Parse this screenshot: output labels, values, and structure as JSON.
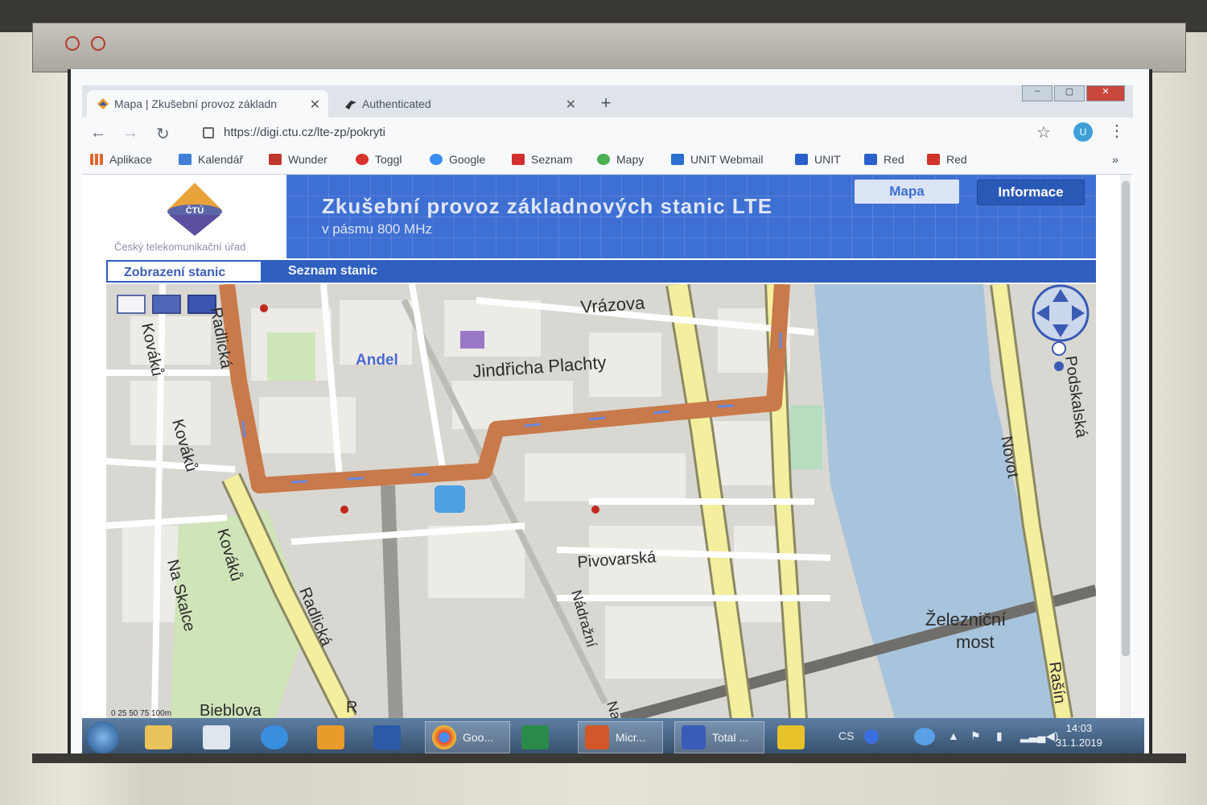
{
  "browser": {
    "tabs": [
      {
        "label": "Mapa | Zkušební provoz základn"
      },
      {
        "label": "Authenticated"
      }
    ],
    "url": "https://digi.ctu.cz/lte-zp/pokryti",
    "avatar_letter": "U",
    "bookmarks": [
      {
        "label": "Aplikace",
        "color": "#e0662b"
      },
      {
        "label": "Kalendář",
        "color": "#3f7fd6"
      },
      {
        "label": "Wunder",
        "color": "#c2372b"
      },
      {
        "label": "Toggl",
        "color": "#d9342b"
      },
      {
        "label": "Google",
        "color": "#3c8df0"
      },
      {
        "label": "Seznam",
        "color": "#d32f2f"
      },
      {
        "label": "Mapy",
        "color": "#4caf50"
      },
      {
        "label": "UNIT Webmail",
        "color": "#2b6fd0"
      },
      {
        "label": "UNIT",
        "color": "#2b5fc9"
      },
      {
        "label": "Red",
        "color": "#2b5fc9"
      },
      {
        "label": "Red",
        "color": "#d1342b"
      }
    ]
  },
  "site": {
    "logo_abbr": "ČTÚ",
    "logo_caption": "Český telekomunikační úřad",
    "title": "Zkušební provoz základnových stanic LTE",
    "subtitle": "v pásmu 800 MHz",
    "nav_buttons": [
      "Mapa",
      "Informace"
    ],
    "subtabs": [
      "Zobrazení stanic",
      "Seznam stanic"
    ]
  },
  "map": {
    "streets": [
      "Vrázova",
      "Jindřicha Plachty",
      "Andel",
      "Radlická",
      "Kováků",
      "Kováků",
      "Kováků",
      "Na Skalce",
      "Radlická",
      "Pivovarská",
      "Nádražní",
      "Na",
      "Bieblova",
      "R",
      "Novot",
      "Podskalská",
      "Železniční",
      "most",
      "Rašín"
    ],
    "scale": "0  25  50  75  100m",
    "colors": {
      "route": "#c87a4a",
      "water": "#a8c4dc",
      "main_road": "#f3ef9e",
      "block": "#d3d1cb"
    }
  },
  "taskbar": {
    "items": [
      "Goo...",
      "Micr...",
      "Total ..."
    ],
    "lang": "CS",
    "time": "14:03",
    "date": "31.1.2019"
  }
}
